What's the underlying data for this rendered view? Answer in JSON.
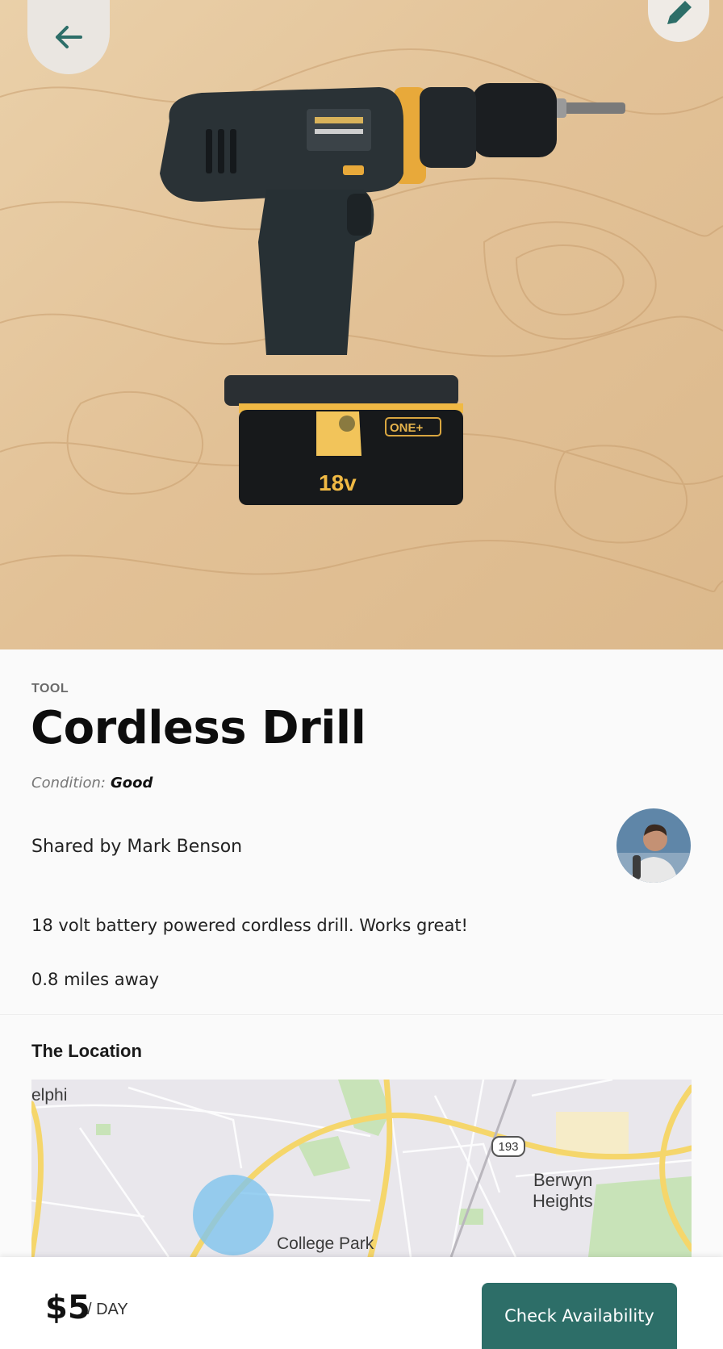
{
  "header": {
    "back_icon": "arrow-left-icon",
    "edit_icon": "pencil-icon"
  },
  "hero": {
    "battery_brand": "ONE+",
    "battery_voltage": "18v"
  },
  "item": {
    "category": "TOOL",
    "title": "Cordless Drill",
    "condition_label": "Condition:",
    "condition_value": "Good",
    "shared_by": "Shared by Mark Benson",
    "description": "18 volt battery powered cordless drill. Works great!",
    "distance": "0.8 miles away"
  },
  "location": {
    "heading": "The Location",
    "map_labels": {
      "place_1": "elphi",
      "place_2": "Berwyn",
      "place_3": "Heights",
      "place_4": "College Park",
      "route": "193"
    }
  },
  "footer": {
    "price": "$5",
    "per": "/ DAY",
    "cta": "Check Availability"
  },
  "colors": {
    "accent": "#2d6e68",
    "map_road": "#f5d66b",
    "map_marker": "#7fc4ee"
  }
}
